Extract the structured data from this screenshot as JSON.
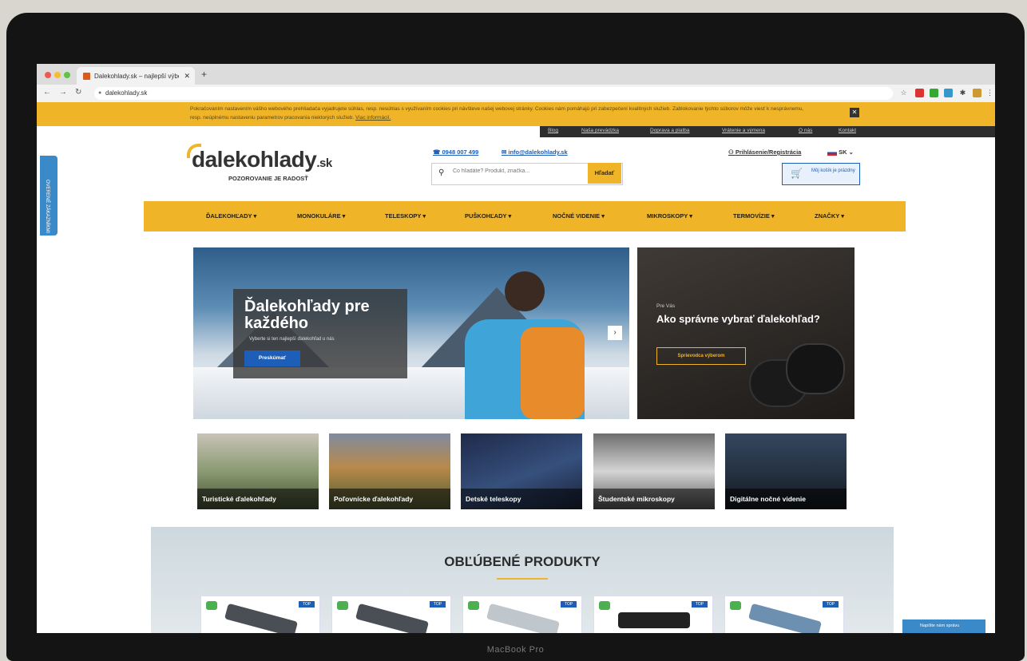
{
  "device": {
    "label": "MacBook Pro"
  },
  "browser": {
    "tab_title": "Dalekohlady.sk – najlepší výbe",
    "tab_close": "✕",
    "new_tab": "+",
    "url": "dalekohlady.sk"
  },
  "cookie": {
    "text": "Pokračovaním nastavením vášho webového prehliadača vyjadrujete súhlas, resp. nesúhlas s využívaním cookies pri návšteve našej webovej stránky. Cookies nám pomáhajú pri zabezpečení kvalitných služieb. Zablokovanie týchto súborov môže viesť k nesprávnemu, resp. neúplnému nastaveniu parametrov pracovania niektorých služieb.",
    "link": "Viac informácií.",
    "close": "✕"
  },
  "topnav": [
    "Blog",
    "Naša prevádzka",
    "Doprava a platba",
    "Vrátenie a výmena",
    "O nás",
    "Kontakt"
  ],
  "header": {
    "logo_main": "dalekohlady",
    "logo_tld": ".sk",
    "logo_tagline": "POZOROVANIE JE RADOSŤ",
    "phone": "0948 007 499",
    "email": "info@dalekohlady.sk",
    "search_placeholder": "Čo hľadáte? Produkt, značka...",
    "search_button": "Hľadať",
    "login": "Prihlásenie/Registrácia",
    "lang": "SK",
    "cart_label": "Môj košík je prázdny"
  },
  "side_tab": "OVERENÉ ZÁKAZNÍKMI",
  "mainnav": [
    "ĎALEKOHĽADY",
    "MONOKULÁRE",
    "TELESKOPY",
    "PUŠKOHĽADY",
    "NOČNÉ VIDENIE",
    "MIKROSKOPY",
    "TERMOVÍZIE",
    "ZNAČKY"
  ],
  "hero": {
    "title": "Ďalekohľady pre každého",
    "subtitle": "Vyberte si ten najlepší ďalekohľad u nás",
    "button": "Preskúmať",
    "next": "›"
  },
  "side_banner": {
    "pre": "Pre Vás",
    "title": "Ako správne vybrať ďalekohľad?",
    "button": "Sprievodca výberom"
  },
  "categories": [
    "Turistické ďalekohľady",
    "Poľovnícke ďalekohľady",
    "Detské teleskopy",
    "Študentské mikroskopy",
    "Digitálne nočné videnie"
  ],
  "products": {
    "heading": "OBĽÚBENÉ PRODUKTY",
    "badge": "TOP"
  },
  "chat": "Napíšte nám správu"
}
